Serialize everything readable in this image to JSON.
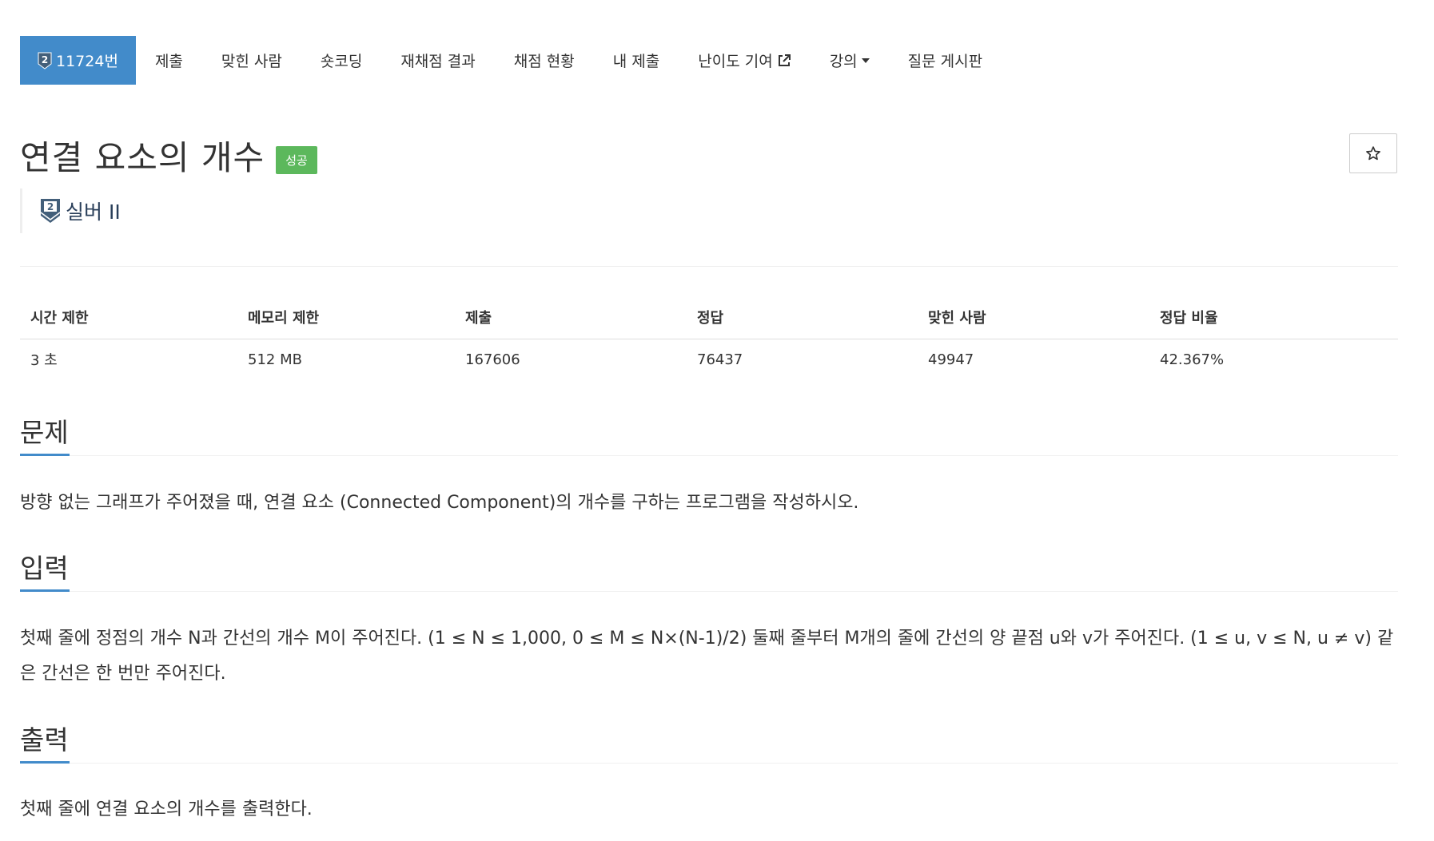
{
  "nav": {
    "problem_number": "11724번",
    "tier_badge_number": "2",
    "items": [
      {
        "label": "제출"
      },
      {
        "label": "맞힌 사람"
      },
      {
        "label": "숏코딩"
      },
      {
        "label": "재채점 결과"
      },
      {
        "label": "채점 현황"
      },
      {
        "label": "내 제출"
      },
      {
        "label": "난이도 기여"
      },
      {
        "label": "강의"
      },
      {
        "label": "질문 게시판"
      }
    ]
  },
  "problem": {
    "title": "연결 요소의 개수",
    "status_badge": "성공",
    "tier_number": "2",
    "tier_label": "실버 II"
  },
  "stats": {
    "headers": [
      "시간 제한",
      "메모리 제한",
      "제출",
      "정답",
      "맞힌 사람",
      "정답 비율"
    ],
    "values": [
      "3 초",
      "512 MB",
      "167606",
      "76437",
      "49947",
      "42.367%"
    ]
  },
  "sections": {
    "description": {
      "title": "문제",
      "text": "방향 없는 그래프가 주어졌을 때, 연결 요소 (Connected Component)의 개수를 구하는 프로그램을 작성하시오."
    },
    "input": {
      "title": "입력",
      "text": "첫째 줄에 정점의 개수 N과 간선의 개수 M이 주어진다. (1 ≤ N ≤ 1,000, 0 ≤ M ≤ N×(N-1)/2) 둘째 줄부터 M개의 줄에 간선의 양 끝점 u와 v가 주어진다. (1 ≤ u, v ≤ N, u ≠ v) 같은 간선은 한 번만 주어진다."
    },
    "output": {
      "title": "출력",
      "text": "첫째 줄에 연결 요소의 개수를 출력한다."
    }
  },
  "colors": {
    "primary": "#428bca",
    "success": "#5cb85c",
    "tier_silver": "#435f7a"
  },
  "icons": [
    "silver-tier-shield-icon",
    "external-link-icon",
    "caret-down-icon",
    "star-icon"
  ]
}
